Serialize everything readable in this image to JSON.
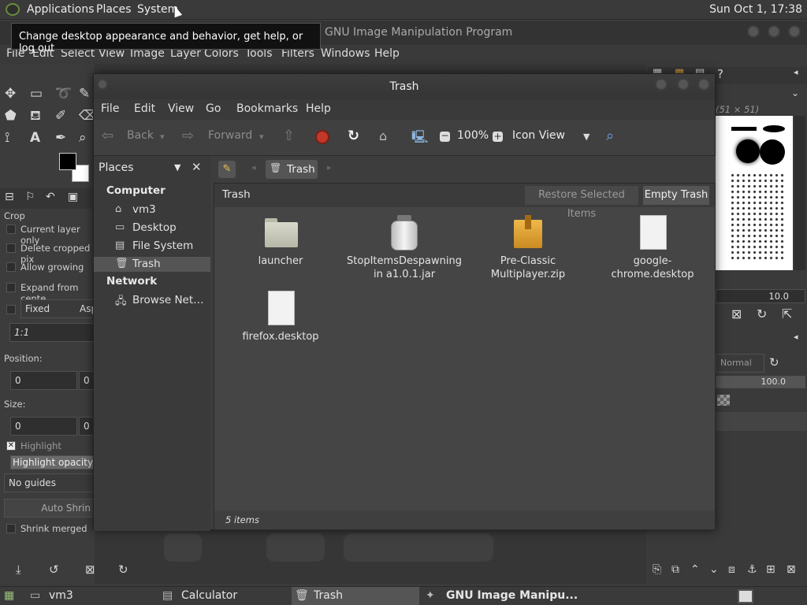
{
  "top_panel": {
    "menus": [
      "Applications",
      "Places",
      "System"
    ],
    "clock": "Sun Oct 1, 17:38"
  },
  "tooltip": "Change desktop appearance and behavior, get help, or log out",
  "gimp": {
    "title": "GNU Image Manipulation Program",
    "menus": [
      "File",
      "Edit",
      "Select",
      "View",
      "Image",
      "Layer",
      "Colors",
      "Tools",
      "Filters",
      "Windows",
      "Help"
    ],
    "tool_options": {
      "title": "Crop",
      "current_layer_only": "Current layer only",
      "delete_cropped": "Delete cropped pix",
      "allow_growing": "Allow growing",
      "expand_from_center": "Expand from cente",
      "fixed": "Fixed",
      "aspect": "Asp",
      "ratio": "1:1",
      "position_label": "Position:",
      "pos_x": "0",
      "pos_y": "0",
      "size_label": "Size:",
      "size_x": "0",
      "size_y": "0",
      "highlight": "Highlight",
      "highlight_opacity": "Highlight opacity",
      "guides": "No guides",
      "auto_shrink": "Auto Shrin",
      "shrink_merged": "Shrink merged"
    },
    "dock": {
      "brush_size": "(51 × 51)",
      "spacing": "10.0",
      "mode": "Normal",
      "opacity": "100.0"
    }
  },
  "file_manager": {
    "title": "Trash",
    "menus": [
      "File",
      "Edit",
      "View",
      "Go",
      "Bookmarks",
      "Help"
    ],
    "toolbar": {
      "back": "Back",
      "forward": "Forward",
      "zoom": "100%",
      "view_mode": "Icon View"
    },
    "sidebar": {
      "combo": "Places",
      "computer_heading": "Computer",
      "computer_items": [
        {
          "label": "vm3",
          "icon": "home-folder-icon"
        },
        {
          "label": "Desktop",
          "icon": "desktop-folder-icon"
        },
        {
          "label": "File System",
          "icon": "drive-icon"
        },
        {
          "label": "Trash",
          "icon": "trash-icon"
        }
      ],
      "network_heading": "Network",
      "network_items": [
        {
          "label": "Browse Net…",
          "icon": "network-icon"
        }
      ]
    },
    "path_button": "Trash",
    "info_label": "Trash",
    "restore_button": "Restore Selected Items",
    "empty_button": "Empty Trash",
    "items": [
      {
        "name": "launcher",
        "icon": "folder-icon"
      },
      {
        "name": "StopItemsDespawning in a1.0.1.jar",
        "icon": "jar-icon"
      },
      {
        "name": "Pre-Classic Multiplayer.zip",
        "icon": "archive-icon"
      },
      {
        "name": "google-chrome.desktop",
        "icon": "file-icon"
      },
      {
        "name": "firefox.desktop",
        "icon": "file-icon"
      }
    ],
    "status": "5 items"
  },
  "taskbar": {
    "tasks": [
      "vm3",
      "Calculator",
      "Trash",
      "GNU Image Manipu..."
    ]
  },
  "colors": {
    "background": "#3b3b3b",
    "selection": "#555555",
    "archive": "#d9a23a",
    "stop_icon": "#c0392b"
  }
}
